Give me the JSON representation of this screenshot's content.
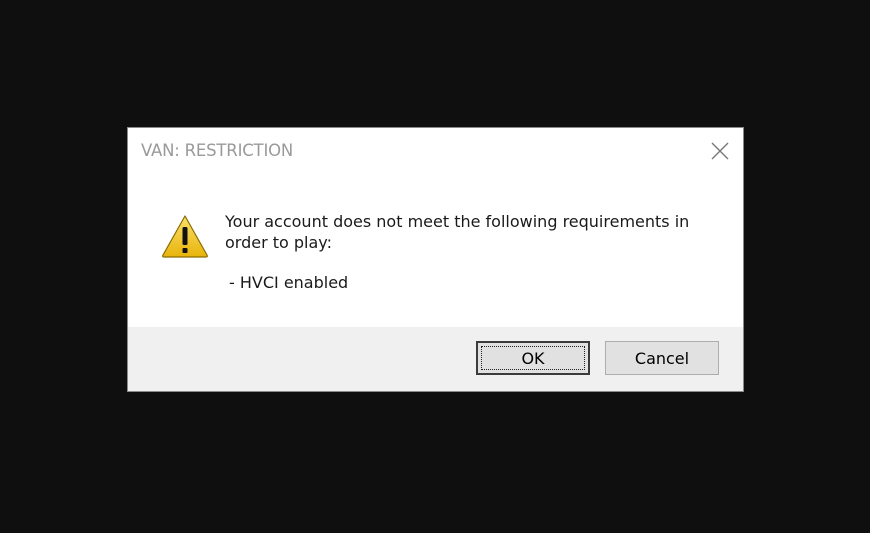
{
  "dialog": {
    "title": "VAN: RESTRICTION",
    "message": "Your account does not meet the following requirements in\norder to play:",
    "requirement": "- HVCI enabled",
    "icon": "warning-icon",
    "close_icon": "close-icon"
  },
  "buttons": {
    "ok_label": "OK",
    "cancel_label": "Cancel"
  },
  "colors": {
    "backdrop": "#0f0f0f",
    "dialog_bg": "#ffffff",
    "footer_bg": "#f0f0f0",
    "warning_yellow": "#f2c314"
  }
}
